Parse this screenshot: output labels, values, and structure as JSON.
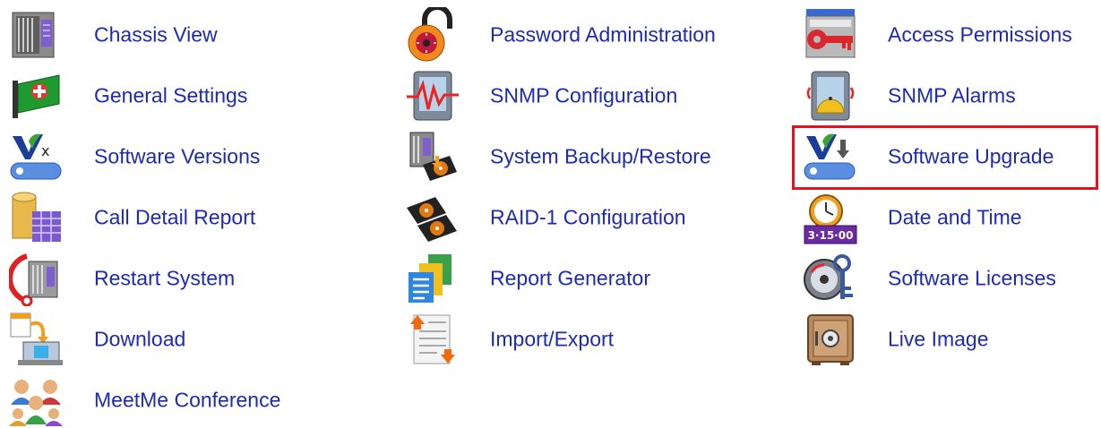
{
  "menu": {
    "columns": [
      {
        "items": [
          {
            "label": "Chassis View",
            "icon": "chassis-icon"
          },
          {
            "label": "General Settings",
            "icon": "card-plus-icon"
          },
          {
            "label": "Software Versions",
            "icon": "software-versions-icon"
          },
          {
            "label": "Call Detail Report",
            "icon": "database-table-icon"
          },
          {
            "label": "Restart System",
            "icon": "restart-icon"
          },
          {
            "label": "Download",
            "icon": "download-icon"
          },
          {
            "label": "MeetMe Conference",
            "icon": "conference-icon"
          }
        ]
      },
      {
        "items": [
          {
            "label": "Password Administration",
            "icon": "padlock-icon"
          },
          {
            "label": "SNMP Configuration",
            "icon": "snmp-config-icon"
          },
          {
            "label": "System Backup/Restore",
            "icon": "backup-icon"
          },
          {
            "label": "RAID-1 Configuration",
            "icon": "raid-disks-icon"
          },
          {
            "label": "Report Generator",
            "icon": "report-icon"
          },
          {
            "label": "Import/Export",
            "icon": "import-export-icon"
          }
        ]
      },
      {
        "items": [
          {
            "label": "Access Permissions",
            "icon": "key-icon"
          },
          {
            "label": "SNMP Alarms",
            "icon": "alarm-icon"
          },
          {
            "label": "Software Upgrade",
            "icon": "software-upgrade-icon"
          },
          {
            "label": "Date and Time",
            "icon": "clock-calendar-icon"
          },
          {
            "label": "Software Licenses",
            "icon": "license-disc-icon"
          },
          {
            "label": "Live Image",
            "icon": "safe-icon"
          }
        ]
      }
    ],
    "highlighted": "Software Upgrade",
    "colors": {
      "link": "#1b2bb5",
      "highlight": "#e0141e"
    }
  }
}
